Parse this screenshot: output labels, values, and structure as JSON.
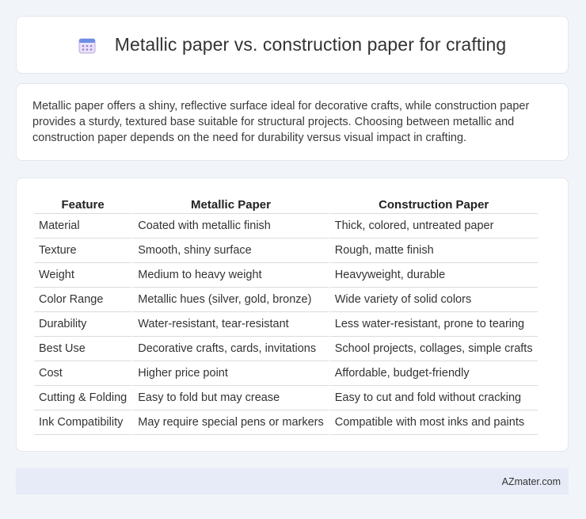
{
  "header": {
    "icon": "calendar-icon",
    "title": "Metallic paper vs. construction paper for crafting"
  },
  "summary": {
    "text": "Metallic paper offers a shiny, reflective surface ideal for decorative crafts, while construction paper provides a sturdy, textured base suitable for structural projects. Choosing between metallic and construction paper depends on the need for durability versus visual impact in crafting."
  },
  "table": {
    "headers": [
      "Feature",
      "Metallic Paper",
      "Construction Paper"
    ],
    "rows": [
      [
        "Material",
        "Coated with metallic finish",
        "Thick, colored, untreated paper"
      ],
      [
        "Texture",
        "Smooth, shiny surface",
        "Rough, matte finish"
      ],
      [
        "Weight",
        "Medium to heavy weight",
        "Heavyweight, durable"
      ],
      [
        "Color Range",
        "Metallic hues (silver, gold, bronze)",
        "Wide variety of solid colors"
      ],
      [
        "Durability",
        "Water-resistant, tear-resistant",
        "Less water-resistant, prone to tearing"
      ],
      [
        "Best Use",
        "Decorative crafts, cards, invitations",
        "School projects, collages, simple crafts"
      ],
      [
        "Cost",
        "Higher price point",
        "Affordable, budget-friendly"
      ],
      [
        "Cutting & Folding",
        "Easy to fold but may crease",
        "Easy to cut and fold without cracking"
      ],
      [
        "Ink Compatibility",
        "May require special pens or markers",
        "Compatible with most inks and paints"
      ]
    ]
  },
  "footer": {
    "brand": "AZmater.com"
  }
}
